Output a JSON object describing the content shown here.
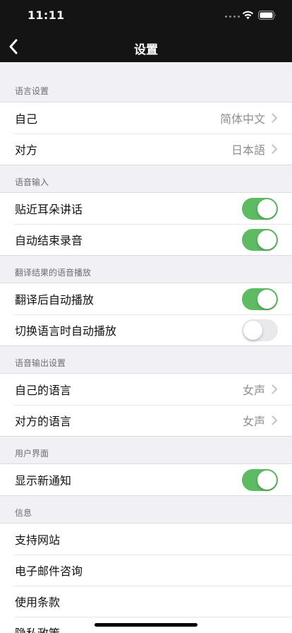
{
  "status_bar": {
    "time": "11:11"
  },
  "nav": {
    "title": "设置"
  },
  "sections": [
    {
      "header": "语言设置",
      "rows": [
        {
          "label": "自己",
          "value": "简体中文",
          "type": "link"
        },
        {
          "label": "对方",
          "value": "日本語",
          "type": "link"
        }
      ]
    },
    {
      "header": "语音输入",
      "rows": [
        {
          "label": "贴近耳朵讲话",
          "type": "toggle",
          "on": true
        },
        {
          "label": "自动结束录音",
          "type": "toggle",
          "on": true
        }
      ]
    },
    {
      "header": "翻译结果的语音播放",
      "rows": [
        {
          "label": "翻译后自动播放",
          "type": "toggle",
          "on": true
        },
        {
          "label": "切换语言时自动播放",
          "type": "toggle",
          "on": false
        }
      ]
    },
    {
      "header": "语音输出设置",
      "rows": [
        {
          "label": "自己的语言",
          "value": "女声",
          "type": "link"
        },
        {
          "label": "对方的语言",
          "value": "女声",
          "type": "link"
        }
      ]
    },
    {
      "header": "用户界面",
      "rows": [
        {
          "label": "显示新通知",
          "type": "toggle",
          "on": true
        }
      ]
    },
    {
      "header": "信息",
      "rows": [
        {
          "label": "支持网站",
          "type": "plain"
        },
        {
          "label": "电子邮件咨询",
          "type": "plain"
        },
        {
          "label": "使用条款",
          "type": "plain"
        },
        {
          "label": "隐私政策",
          "type": "plain"
        }
      ]
    }
  ],
  "colors": {
    "toggle_on": "#5dbb63",
    "toggle_off": "#e9e9eb",
    "bar_background": "#141414",
    "page_background": "#f0f0f5"
  },
  "icons": [
    "back-chevron-icon",
    "chevron-right-icon",
    "wifi-icon",
    "battery-icon",
    "signal-icon"
  ]
}
